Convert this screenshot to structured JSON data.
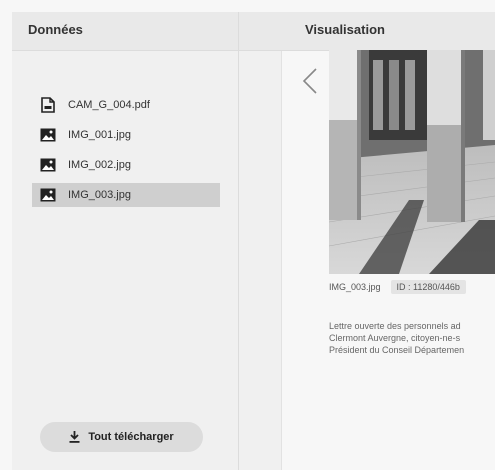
{
  "left_panel": {
    "title": "Données",
    "files": [
      {
        "name": "CAM_G_004.pdf",
        "icon": "pdf-file-icon"
      },
      {
        "name": "IMG_001.jpg",
        "icon": "image-icon"
      },
      {
        "name": "IMG_002.jpg",
        "icon": "image-icon"
      },
      {
        "name": "IMG_003.jpg",
        "icon": "image-icon",
        "selected": true
      }
    ],
    "download_label": "Tout télécharger"
  },
  "right_panel": {
    "title": "Visualisation",
    "image_caption": "IMG_003.jpg",
    "image_id": "ID : 11280/446b",
    "description_lines": [
      "Lettre ouverte des personnels ad",
      "Clermont Auvergne, citoyen-ne-s",
      "Président du Conseil Départemen"
    ]
  },
  "colors": {
    "selected_row": "#cfcfcf",
    "button_bg": "#dcdcdc"
  }
}
